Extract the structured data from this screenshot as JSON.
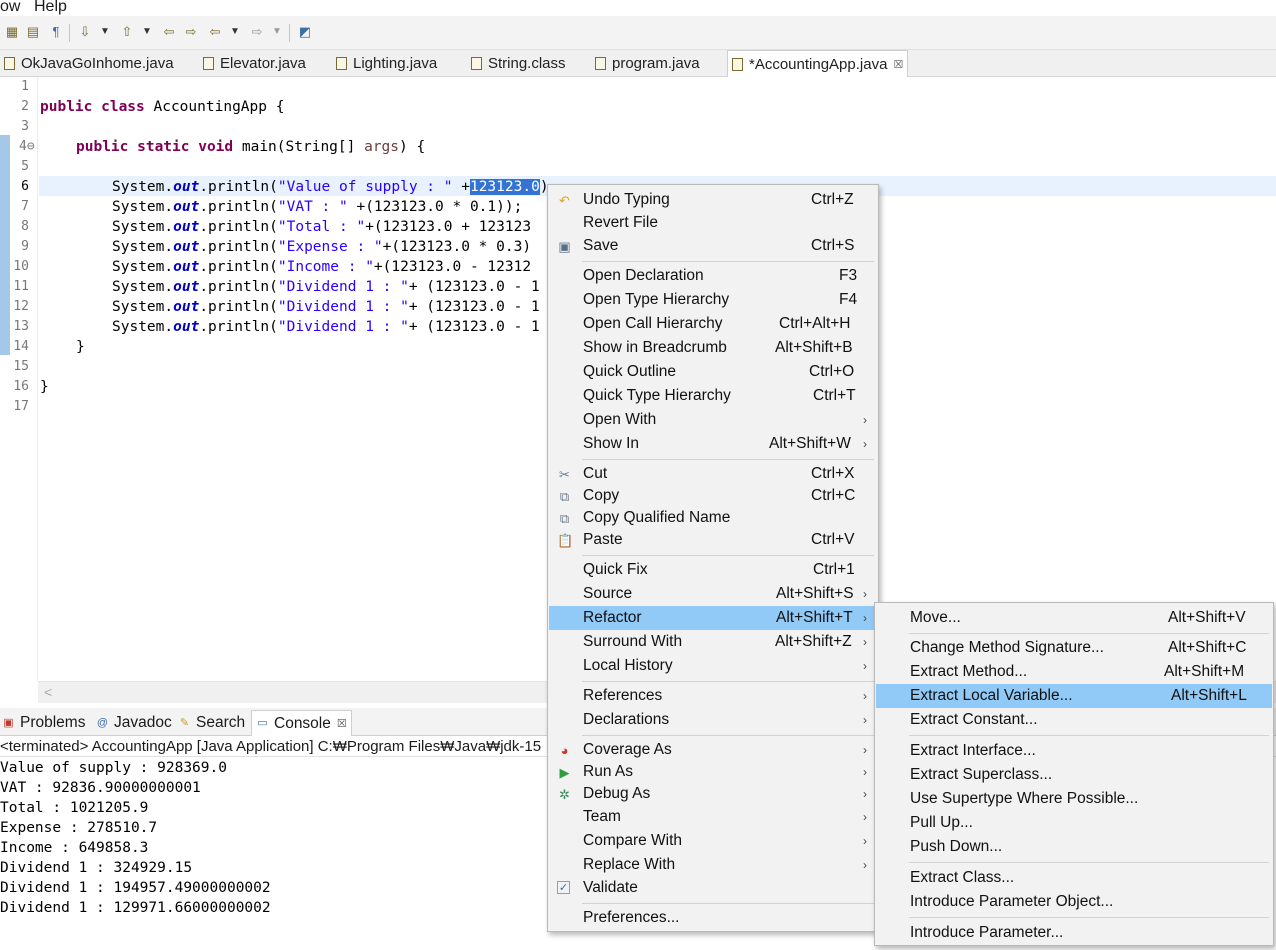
{
  "menubar": {
    "items": [
      "ow",
      "Help"
    ]
  },
  "toolbar": {
    "icons": [
      "open-type-icon",
      "open-resource-icon",
      "show-whitespace-icon",
      "next-annotation-icon",
      "previous-annotation-icon",
      "last-edit-location-icon",
      "back-icon",
      "forward-icon",
      "pin-editor-icon"
    ]
  },
  "editor_tabs": [
    {
      "label": "OkJavaGoInhome.java",
      "icon": "java-file-icon",
      "active": false
    },
    {
      "label": "Elevator.java",
      "icon": "java-file-icon",
      "active": false
    },
    {
      "label": "Lighting.java",
      "icon": "java-file-icon",
      "active": false
    },
    {
      "label": "String.class",
      "icon": "class-file-icon",
      "active": false
    },
    {
      "label": "program.java",
      "icon": "java-file-icon",
      "active": false
    },
    {
      "label": "*AccountingApp.java",
      "icon": "java-file-icon",
      "active": true,
      "close": "☒"
    }
  ],
  "editor": {
    "line_numbers": [
      "1",
      "2",
      "3",
      "4⊖",
      "5",
      "6",
      "7",
      "8",
      "9",
      "10",
      "11",
      "12",
      "13",
      "14",
      "15",
      "16",
      "17"
    ],
    "lines": {
      "l2": {
        "kw": "public class",
        "name": " AccountingApp {"
      },
      "l4": {
        "kw": "public static void",
        "pre": " main(String[] ",
        "param": "args",
        "post": ") {"
      },
      "l6": {
        "pre": "System.",
        "fld": "out",
        "mid": ".println(",
        "str": "\"Value of supply : \"",
        "post": " +",
        "sel": "123123.0",
        "tail": ")"
      },
      "l7": {
        "pre": "System.",
        "fld": "out",
        "mid": ".println(",
        "str": "\"VAT : \"",
        "post": " +(123123.0 * 0.1));"
      },
      "l8": {
        "pre": "System.",
        "fld": "out",
        "mid": ".println(",
        "str": "\"Total : \"",
        "post": "+(123123.0 + 123123"
      },
      "l9": {
        "pre": "System.",
        "fld": "out",
        "mid": ".println(",
        "str": "\"Expense : \"",
        "post": "+(123123.0 * 0.3)"
      },
      "l10": {
        "pre": "System.",
        "fld": "out",
        "mid": ".println(",
        "str": "\"Income : \"",
        "post": "+(123123.0 - 12312"
      },
      "l11": {
        "pre": "System.",
        "fld": "out",
        "mid": ".println(",
        "str": "\"Dividend 1 : \"",
        "post": "+ (123123.0 - 1"
      },
      "l12": {
        "pre": "System.",
        "fld": "out",
        "mid": ".println(",
        "str": "\"Dividend 1 : \"",
        "post": "+ (123123.0 - 1"
      },
      "l13": {
        "pre": "System.",
        "fld": "out",
        "mid": ".println(",
        "str": "\"Dividend 1 : \"",
        "post": "+ (123123.0 - 1"
      },
      "l14": "}",
      "l16": "}"
    },
    "scroll_left": "<"
  },
  "views": {
    "tabs": [
      {
        "label": "Problems",
        "icon": "problems-icon"
      },
      {
        "label": "Javadoc",
        "icon": "javadoc-icon"
      },
      {
        "label": "Search",
        "icon": "search-icon"
      },
      {
        "label": "Console",
        "icon": "console-icon",
        "active": true,
        "close": "☒"
      }
    ],
    "console_header": "<terminated> AccountingApp [Java Application] C:₩Program Files₩Java₩jdk-15",
    "console_lines": [
      "Value of supply : 928369.0",
      "VAT : 92836.90000000001",
      "Total : 1021205.9",
      "Expense : 278510.7",
      "Income : 649858.3",
      "Dividend 1 : 324929.15",
      "Dividend 1 : 194957.49000000002",
      "Dividend 1 : 129971.66000000002"
    ]
  },
  "context_menu": {
    "items": [
      {
        "label": "Undo Typing",
        "shortcut": "Ctrl+Z",
        "icon": "undo-icon"
      },
      {
        "label": "Revert File",
        "shortcut": ""
      },
      {
        "label": "Save",
        "shortcut": "Ctrl+S",
        "icon": "save-icon"
      },
      {
        "label": "Open Declaration",
        "shortcut": "F3"
      },
      {
        "label": "Open Type Hierarchy",
        "shortcut": "F4"
      },
      {
        "label": "Open Call Hierarchy",
        "shortcut": "Ctrl+Alt+H"
      },
      {
        "label": "Show in Breadcrumb",
        "shortcut": "Alt+Shift+B"
      },
      {
        "label": "Quick Outline",
        "shortcut": "Ctrl+O"
      },
      {
        "label": "Quick Type Hierarchy",
        "shortcut": "Ctrl+T"
      },
      {
        "label": "Open With",
        "shortcut": "",
        "submenu": true
      },
      {
        "label": "Show In",
        "shortcut": "Alt+Shift+W",
        "submenu": true
      },
      {
        "label": "Cut",
        "shortcut": "Ctrl+X",
        "icon": "cut-icon"
      },
      {
        "label": "Copy",
        "shortcut": "Ctrl+C",
        "icon": "copy-icon"
      },
      {
        "label": "Copy Qualified Name",
        "shortcut": "",
        "icon": "copy-qualified-name-icon"
      },
      {
        "label": "Paste",
        "shortcut": "Ctrl+V",
        "icon": "paste-icon"
      },
      {
        "label": "Quick Fix",
        "shortcut": "Ctrl+1"
      },
      {
        "label": "Source",
        "shortcut": "Alt+Shift+S",
        "submenu": true
      },
      {
        "label": "Refactor",
        "shortcut": "Alt+Shift+T",
        "submenu": true,
        "highlighted": true
      },
      {
        "label": "Surround With",
        "shortcut": "Alt+Shift+Z",
        "submenu": true
      },
      {
        "label": "Local History",
        "shortcut": "",
        "submenu": true
      },
      {
        "label": "References",
        "shortcut": "",
        "submenu": true
      },
      {
        "label": "Declarations",
        "shortcut": "",
        "submenu": true
      },
      {
        "label": "Coverage As",
        "shortcut": "",
        "submenu": true,
        "icon": "coverage-icon"
      },
      {
        "label": "Run As",
        "shortcut": "",
        "submenu": true,
        "icon": "run-icon"
      },
      {
        "label": "Debug As",
        "shortcut": "",
        "submenu": true,
        "icon": "debug-icon"
      },
      {
        "label": "Team",
        "shortcut": "",
        "submenu": true
      },
      {
        "label": "Compare With",
        "shortcut": "",
        "submenu": true
      },
      {
        "label": "Replace With",
        "shortcut": "",
        "submenu": true
      },
      {
        "label": "Validate",
        "shortcut": "",
        "icon": "validate-check-icon"
      },
      {
        "label": "Preferences...",
        "shortcut": ""
      }
    ]
  },
  "refactor_submenu": {
    "items": [
      {
        "label": "Move...",
        "shortcut": "Alt+Shift+V"
      },
      {
        "label": "Change Method Signature...",
        "shortcut": "Alt+Shift+C"
      },
      {
        "label": "Extract Method...",
        "shortcut": "Alt+Shift+M"
      },
      {
        "label": "Extract Local Variable...",
        "shortcut": "Alt+Shift+L",
        "highlighted": true
      },
      {
        "label": "Extract Constant...",
        "shortcut": ""
      },
      {
        "label": "Extract Interface...",
        "shortcut": ""
      },
      {
        "label": "Extract Superclass...",
        "shortcut": ""
      },
      {
        "label": "Use Supertype Where Possible...",
        "shortcut": ""
      },
      {
        "label": "Pull Up...",
        "shortcut": ""
      },
      {
        "label": "Push Down...",
        "shortcut": ""
      },
      {
        "label": "Extract Class...",
        "shortcut": ""
      },
      {
        "label": "Introduce Parameter Object...",
        "shortcut": ""
      },
      {
        "label": "Introduce Parameter...",
        "shortcut": ""
      }
    ]
  },
  "colors": {
    "selection": "#3373d6",
    "menu_highlight": "#91c9f7",
    "keyword": "#7f0055",
    "string": "#2a00ff",
    "field": "#0000c0",
    "current_line": "#e8f2fe"
  }
}
